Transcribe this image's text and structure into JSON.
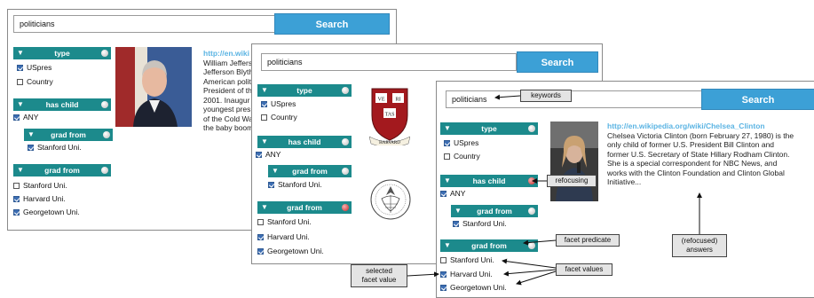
{
  "query": "politicians",
  "search_label": "Search",
  "panel1": {
    "facets": [
      {
        "title": "type",
        "items": [
          {
            "label": "USpres",
            "checked": true
          },
          {
            "label": "Country",
            "checked": false
          }
        ]
      },
      {
        "title": "has child",
        "any_label": "ANY"
      },
      {
        "title": "grad from",
        "items": [
          {
            "label": "Stanford Uni.",
            "checked": true
          }
        ]
      },
      {
        "title": "grad from",
        "items": [
          {
            "label": "Stanford Uni.",
            "checked": false
          },
          {
            "label": "Harvard Uni.",
            "checked": true
          },
          {
            "label": "Georgetown Uni.",
            "checked": true
          }
        ]
      }
    ],
    "result": {
      "url": "http://en.wiki",
      "lines": [
        "William Jeffers",
        "Jefferson Blyth",
        "American politi",
        "President of th",
        "2001. Inaugur",
        "youngest pres",
        "of the Cold Wa",
        "the baby boom"
      ]
    }
  },
  "panel2": {
    "facets": [
      {
        "title": "type",
        "items": [
          {
            "label": "USpres",
            "checked": true
          },
          {
            "label": "Country",
            "checked": false
          }
        ]
      },
      {
        "title": "has child",
        "any_label": "ANY"
      },
      {
        "title": "grad from",
        "items": [
          {
            "label": "Stanford Uni.",
            "checked": true
          }
        ]
      },
      {
        "title": "grad from",
        "items": [
          {
            "label": "Stanford Uni.",
            "checked": false
          },
          {
            "label": "Harvard Uni.",
            "checked": true
          },
          {
            "label": "Georgetown Uni.",
            "checked": true
          }
        ]
      }
    ],
    "harvard_shield_text": [
      "VE",
      "RI",
      "TAS"
    ],
    "harvard_banner_text": "HARVARD"
  },
  "panel3": {
    "facets": [
      {
        "title": "type",
        "items": [
          {
            "label": "USpres",
            "checked": true
          },
          {
            "label": "Country",
            "checked": false
          }
        ]
      },
      {
        "title": "has child",
        "any_label": "ANY"
      },
      {
        "title": "grad from",
        "items": [
          {
            "label": "Stanford Uni.",
            "checked": true
          }
        ]
      },
      {
        "title": "grad from",
        "items": [
          {
            "label": "Stanford Uni.",
            "checked": false
          },
          {
            "label": "Harvard Uni.",
            "checked": true
          },
          {
            "label": "Georgetown Uni.",
            "checked": true
          }
        ]
      }
    ],
    "result": {
      "url": "http://en.wikipedia.org/wiki/Chelsea_Clinton",
      "lines": [
        "Chelsea Victoria Clinton (born February 27, 1980) is the",
        "only child of former U.S. President Bill Clinton and",
        "former U.S. Secretary of State Hillary Rodham Clinton.",
        "She is a special correspondent for NBC News, and",
        "works with the Clinton Foundation and Clinton Global",
        "Initiative..."
      ]
    }
  },
  "callouts": {
    "keywords": "keywords",
    "refocusing": "refocusing",
    "facet_predicate": "facet predicate",
    "facet_values": "facet values",
    "selected_facet_value": [
      "selected",
      "facet value"
    ],
    "refocused_answers": [
      "(refocused)",
      "answers"
    ]
  },
  "colors": {
    "facet_header": "#1c8a8c",
    "search_button": "#3ca0d6",
    "url": "#5bb4e3",
    "active_dot": "#c62828"
  }
}
